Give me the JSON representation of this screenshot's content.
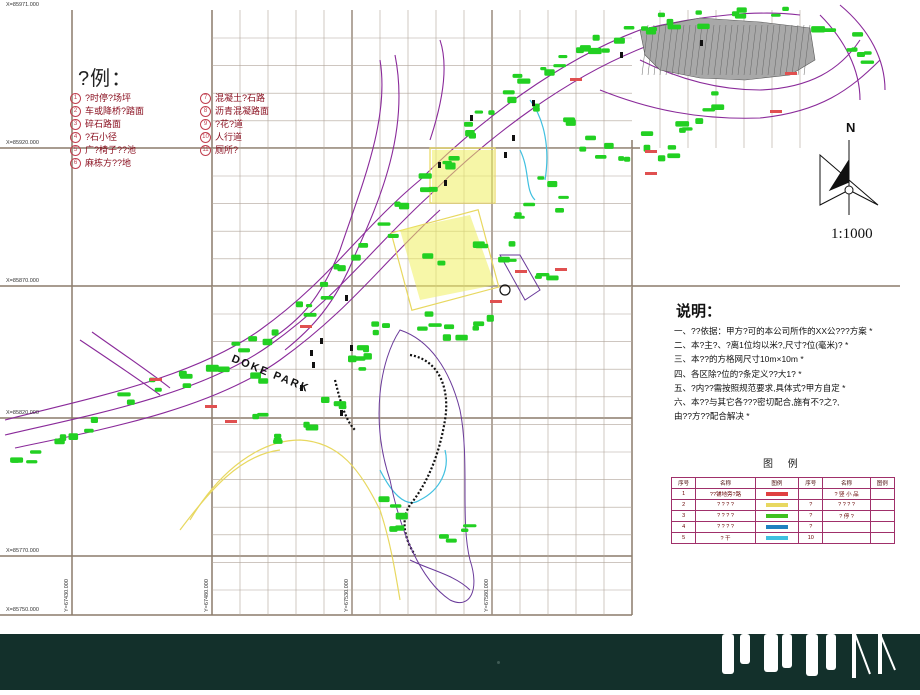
{
  "legend": {
    "title": "?例：",
    "items_left": [
      {
        "num": "1",
        "label": "?时停?场坪"
      },
      {
        "num": "2",
        "label": "车或降桥?踏面"
      },
      {
        "num": "3",
        "label": "碎石路面"
      },
      {
        "num": "4",
        "label": "?石小径"
      },
      {
        "num": "5",
        "label": "广?椅子??池"
      },
      {
        "num": "6",
        "label": "麻栋方??地"
      }
    ],
    "items_right": [
      {
        "num": "7",
        "label": "混凝土?石路"
      },
      {
        "num": "8",
        "label": "沥青混凝路面"
      },
      {
        "num": "9",
        "label": "?花?道"
      },
      {
        "num": "10",
        "label": "人行道"
      },
      {
        "num": "11",
        "label": "厕所?"
      }
    ]
  },
  "coords": {
    "top": "X=85971.000",
    "h1": "X=85920.000",
    "h2": "X=85870.000",
    "h3": "X=85820.000",
    "h4": "X=85770.000",
    "h5": "X=85750.000",
    "v1": "Y=67430.000",
    "v2": "Y=67480.000",
    "v3": "Y=67530.000",
    "v4": "Y=67580.000"
  },
  "north": {
    "letter": "N",
    "scale": "1:1000"
  },
  "park_label": "DOKE PARK",
  "notes": {
    "title": "说明：",
    "lines": [
      "一、??依据：甲方?可的本公司所作的XX公???方案 *",
      "二、本?主?、?离1位均以米?,尺寸?位(毫米)? *",
      "三、本??的方格网尺寸10m×10m *",
      "四、各区除?位的?条定义??大1? *",
      "五、?内??需按照规范要求,具体式?甲方自定 *",
      "六、本??与其它各???密切配合,施有不?之?,",
      "    由??方??配合解决 *"
    ]
  },
  "legend_table": {
    "title": "图 例",
    "headers": [
      "序号",
      "名称",
      "图例",
      "序号",
      "名称",
      "图例"
    ],
    "rows": [
      [
        "1",
        "??铺地旁?路",
        "",
        "",
        "? 竖 小 品",
        ""
      ],
      [
        "2",
        "? ? ? ?",
        "",
        "?",
        "? ? ? ?",
        ""
      ],
      [
        "3",
        "? ? ? ?",
        "",
        "?",
        "? 停 ?",
        ""
      ],
      [
        "4",
        "? ? ? ?",
        "",
        "?",
        "",
        ""
      ],
      [
        "5",
        "? 干",
        "",
        "10",
        "",
        ""
      ]
    ]
  },
  "colors": {
    "grid": "#8c7c6b",
    "road": "#7a1e8a",
    "green": "#20d020",
    "yellow": "#e8e860",
    "cyan": "#40c0e0",
    "bar": "#13302b"
  }
}
